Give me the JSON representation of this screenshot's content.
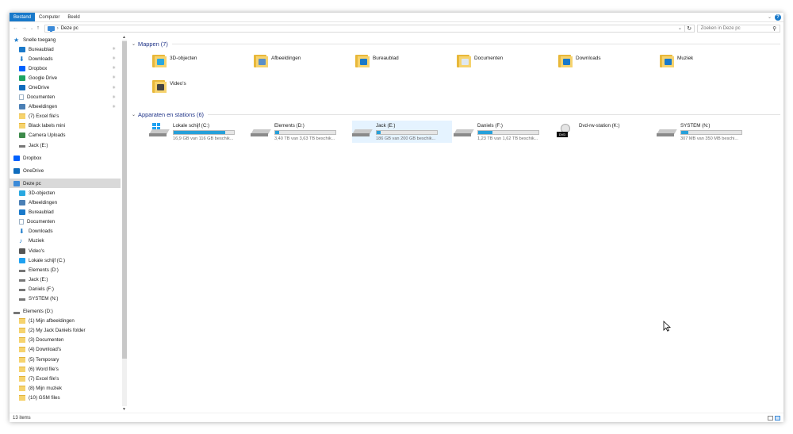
{
  "ribbon": {
    "tabs": [
      "Bestand",
      "Computer",
      "Beeld"
    ]
  },
  "address": {
    "path": "Deze pc",
    "search_placeholder": "Zoeken in Deze pc"
  },
  "nav": {
    "items": [
      {
        "label": "Snelle toegang",
        "level": 0,
        "icon": "star-icon",
        "color": "#1979ca"
      },
      {
        "label": "Bureaublad",
        "level": 1,
        "icon": "desktop-icon",
        "color": "#1979ca",
        "pinned": true
      },
      {
        "label": "Downloads",
        "level": 1,
        "icon": "download-icon",
        "color": "#1979ca",
        "pinned": true
      },
      {
        "label": "Dropbox",
        "level": 1,
        "icon": "dropbox-icon",
        "color": "#0061fe",
        "pinned": true
      },
      {
        "label": "Google Drive",
        "level": 1,
        "icon": "google-drive-icon",
        "color": "#1da462",
        "pinned": true
      },
      {
        "label": "OneDrive",
        "level": 1,
        "icon": "onedrive-icon",
        "color": "#0f6cbd",
        "pinned": true
      },
      {
        "label": "Documenten",
        "level": 1,
        "icon": "documents-icon",
        "color": "#9fb4c7",
        "pinned": true
      },
      {
        "label": "Afbeeldingen",
        "level": 1,
        "icon": "pictures-icon",
        "color": "#4a7fb5",
        "pinned": true
      },
      {
        "label": "(7) Excel file's",
        "level": 1,
        "icon": "folder-icon",
        "color": "#f6d36e"
      },
      {
        "label": "Black labels mini",
        "level": 1,
        "icon": "folder-icon",
        "color": "#f6d36e"
      },
      {
        "label": "Camera Uploads",
        "level": 1,
        "icon": "camera-uploads-icon",
        "color": "#3d8a4a"
      },
      {
        "label": "Jack (E:)",
        "level": 1,
        "icon": "drive-icon",
        "color": "#777777"
      },
      {
        "label": "Dropbox",
        "level": 0,
        "icon": "dropbox-icon",
        "color": "#0061fe",
        "gap": true
      },
      {
        "label": "OneDrive",
        "level": 0,
        "icon": "onedrive-icon",
        "color": "#0f6cbd",
        "gap": true
      },
      {
        "label": "Deze pc",
        "level": 0,
        "icon": "pc-icon",
        "color": "#3b8ad8",
        "gap": true,
        "selected": true
      },
      {
        "label": "3D-objecten",
        "level": 1,
        "icon": "3d-objects-icon",
        "color": "#29a8e0"
      },
      {
        "label": "Afbeeldingen",
        "level": 1,
        "icon": "pictures-icon",
        "color": "#4a7fb5"
      },
      {
        "label": "Bureaublad",
        "level": 1,
        "icon": "desktop-icon",
        "color": "#1979ca"
      },
      {
        "label": "Documenten",
        "level": 1,
        "icon": "documents-icon",
        "color": "#9fb4c7"
      },
      {
        "label": "Downloads",
        "level": 1,
        "icon": "download-icon",
        "color": "#1979ca"
      },
      {
        "label": "Muziek",
        "level": 1,
        "icon": "music-icon",
        "color": "#1979ca"
      },
      {
        "label": "Video's",
        "level": 1,
        "icon": "videos-icon",
        "color": "#555555"
      },
      {
        "label": "Lokale schijf (C:)",
        "level": 1,
        "icon": "system-drive-icon",
        "color": "#1ea1f1"
      },
      {
        "label": "Elements (D:)",
        "level": 1,
        "icon": "drive-icon",
        "color": "#777777"
      },
      {
        "label": "Jack (E:)",
        "level": 1,
        "icon": "drive-icon",
        "color": "#777777"
      },
      {
        "label": "Daniels (F:)",
        "level": 1,
        "icon": "drive-icon",
        "color": "#777777"
      },
      {
        "label": "SYSTEM (N:)",
        "level": 1,
        "icon": "drive-icon",
        "color": "#777777"
      },
      {
        "label": "Elements (D:)",
        "level": 0,
        "icon": "drive-icon",
        "color": "#777777",
        "gap": true
      },
      {
        "label": "(1) Mijn afbeeldingen",
        "level": 1,
        "icon": "folder-icon",
        "color": "#f6d36e"
      },
      {
        "label": "(2) My Jack Daniels folder",
        "level": 1,
        "icon": "folder-icon",
        "color": "#f6d36e"
      },
      {
        "label": "(3) Documenten",
        "level": 1,
        "icon": "folder-icon",
        "color": "#f6d36e"
      },
      {
        "label": "(4) Download's",
        "level": 1,
        "icon": "folder-icon",
        "color": "#f6d36e"
      },
      {
        "label": "(5) Temporary",
        "level": 1,
        "icon": "folder-icon",
        "color": "#f6d36e"
      },
      {
        "label": "(6) Word file's",
        "level": 1,
        "icon": "folder-icon",
        "color": "#f6d36e"
      },
      {
        "label": "(7) Excel file's",
        "level": 1,
        "icon": "folder-icon",
        "color": "#f6d36e"
      },
      {
        "label": "(8) Mijn muziek",
        "level": 1,
        "icon": "folder-icon",
        "color": "#f6d36e"
      },
      {
        "label": "(10)  GSM files",
        "level": 1,
        "icon": "folder-icon",
        "color": "#f6d36e"
      }
    ]
  },
  "folders": {
    "header": "Mappen (7)",
    "items": [
      {
        "label": "3D-objecten",
        "icon": "3d-objects-folder-icon",
        "overlay": "#29a8e0"
      },
      {
        "label": "Afbeeldingen",
        "icon": "pictures-folder-icon",
        "overlay": "#5b8fc7"
      },
      {
        "label": "Bureaublad",
        "icon": "desktop-folder-icon",
        "overlay": "#1979ca"
      },
      {
        "label": "Documenten",
        "icon": "documents-folder-icon",
        "overlay": "#dfe8f0"
      },
      {
        "label": "Downloads",
        "icon": "downloads-folder-icon",
        "overlay": "#1979ca"
      },
      {
        "label": "Muziek",
        "icon": "music-folder-icon",
        "overlay": "#1979ca"
      },
      {
        "label": "Video's",
        "icon": "videos-folder-icon",
        "overlay": "#444444"
      }
    ]
  },
  "drives": {
    "header": "Apparaten en stations (6)",
    "items": [
      {
        "name": "Lokale schijf (C:)",
        "free": "16,9 GB van 116 GB beschik...",
        "used_fraction": 0.85,
        "icon": "system-drive-icon"
      },
      {
        "name": "Elements (D:)",
        "free": "3,40 TB van 3,63 TB beschik...",
        "used_fraction": 0.06,
        "icon": "drive-icon"
      },
      {
        "name": "Jack (E:)",
        "free": "186 GB van 200 GB beschik...",
        "used_fraction": 0.07,
        "icon": "drive-icon",
        "highlighted": true
      },
      {
        "name": "Daniels (F:)",
        "free": "1,23 TB van 1,62 TB beschik...",
        "used_fraction": 0.24,
        "icon": "drive-icon"
      },
      {
        "name": "Dvd-rw-station (K:)",
        "free": "",
        "used_fraction": null,
        "icon": "dvd-drive-icon"
      },
      {
        "name": "SYSTEM (N:)",
        "free": "307 MB van 350 MB beschi...",
        "used_fraction": 0.12,
        "icon": "drive-icon"
      }
    ]
  },
  "dvd_badge": "DVD",
  "status": {
    "count": "13 items"
  },
  "colors": {
    "accent": "#1979ca",
    "bar_fill": "#26a0da",
    "selection": "#e5f3ff",
    "group_header": "#1e3287"
  }
}
